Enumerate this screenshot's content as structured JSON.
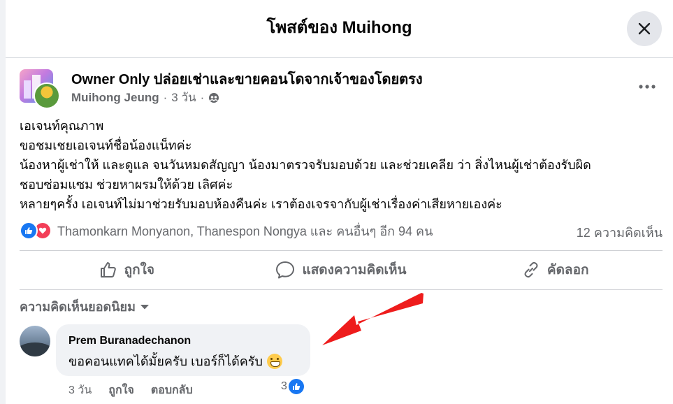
{
  "modal": {
    "title": "โพสต์ของ Muihong"
  },
  "post": {
    "group_name": "Owner Only ปล่อยเช่าและขายคอนโดจากเจ้าของโดยตรง",
    "author": "Muihong Jeung",
    "separator": "·",
    "time": "3 วัน",
    "separator2": "·",
    "body_lines": [
      "เอเจนท์คุณภาพ",
      "ขอชมเชยเอเจนท์ชื่อน้องแน็ทค่ะ",
      "น้องหาผู้เช่าให้ และดูแล จนวันหมดสัญญา น้องมาตรวจรับมอบด้วย และช่วยเคลีย ว่า สิ่งไหนผู้เช่าต้องรับผิดชอบซ่อมแซม ช่วยหาผรมให้ด้วย เลิศค่ะ",
      "หลายๆครั้ง เอเจนท์ไม่มาช่วยรับมอบห้องคืนค่ะ เราต้องเจรจากับผู้เช่าเรื่องค่าเสียหายเองค่ะ"
    ],
    "body_display": [
      "เอเจนท์คุณภาพ",
      "ขอชมเชยเอเจนท์ชื่อน้องแน็ทค่ะ",
      "น้องหาผู้เช่าให้ และดูแล จนวันหมดสัญญา น้องมาตรวจรับมอบด้วย และช่วยเคลีย ว่า สิ่งไหนผู้เช่าต้องรับผิด",
      "ชอบซ่อมแซม ช่วยหาผรมให้ด้วย เลิศค่ะ",
      "หลายๆครั้ง เอเจนท์ไม่มาช่วยรับมอบห้องคืนค่ะ เราต้องเจรจากับผู้เช่าเรื่องค่าเสียหายเองค่ะ"
    ],
    "reactions_text": "Thamonkarn Monyanon, Thanespon Nongya และ คนอื่นๆ อีก 94 คน",
    "comment_count": "12 ความคิดเห็น"
  },
  "actions": {
    "like": "ถูกใจ",
    "comment": "แสดงความคิดเห็น",
    "share": "คัดลอก"
  },
  "comments_section": {
    "sort_label": "ความคิดเห็นยอดนิยม"
  },
  "comment": {
    "author": "Prem Buranadechanon",
    "text": "ขอคอนแทคได้มั้ยครับ เบอร์ก็ได้ครับ",
    "emoji": "grinning-face-emoji",
    "time": "3 วัน",
    "like_label": "ถูกใจ",
    "reply_label": "ตอบกลับ",
    "like_count": "3"
  },
  "colors": {
    "facebook_blue": "#1877f2",
    "love_red": "#f33e58",
    "annotation_arrow": "#ee1c1c",
    "secondary_text": "#65676b"
  }
}
